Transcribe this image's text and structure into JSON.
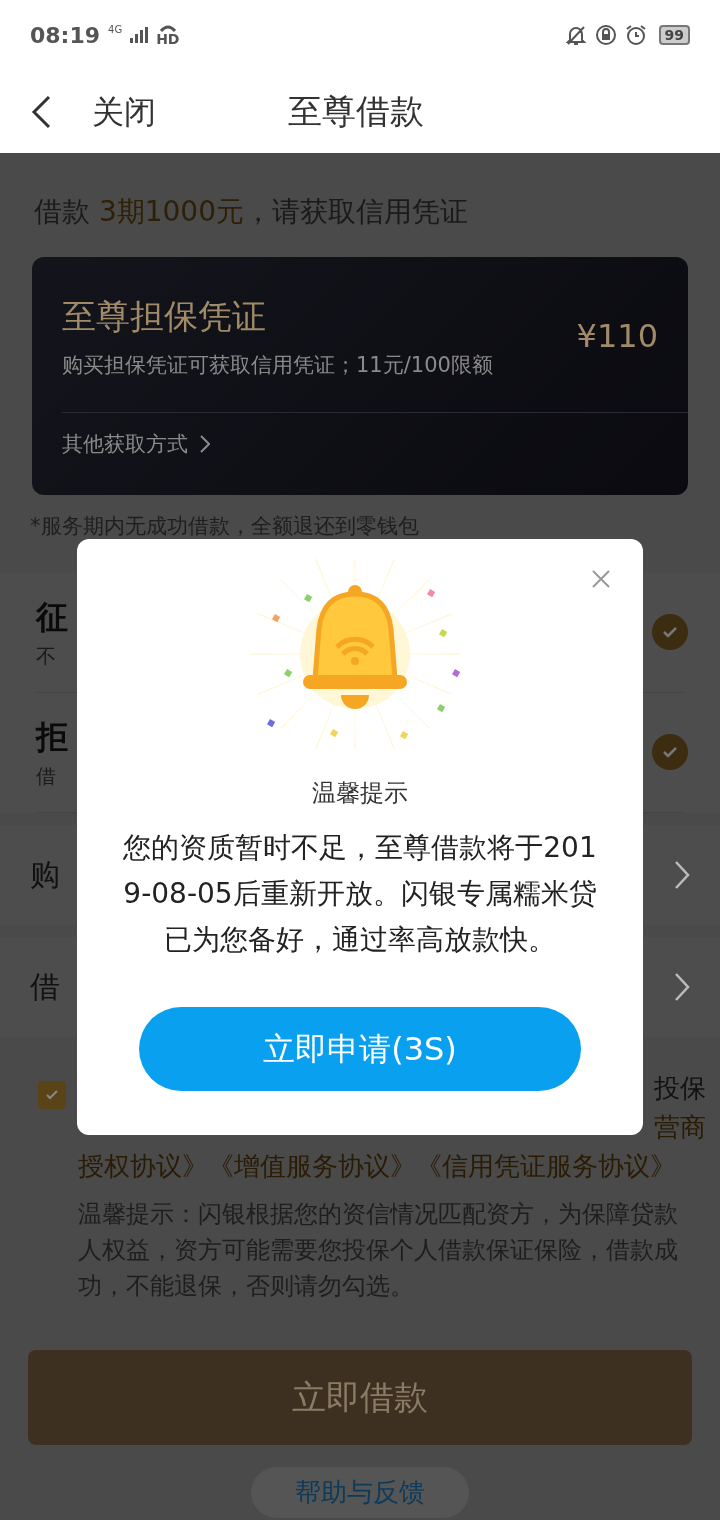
{
  "status_bar": {
    "time": "08:19",
    "network": "4G",
    "call_label": "HD",
    "battery": "99"
  },
  "header": {
    "back_label": "关闭",
    "title": "至尊借款"
  },
  "loan_summary": {
    "prefix": "借款",
    "highlight": "3期1000元",
    "suffix": "，请获取信用凭证"
  },
  "voucher_card": {
    "title": "至尊担保凭证",
    "description": "购买担保凭证可获取信用凭证；11元/100限额",
    "price": "¥110",
    "other_methods": "其他获取方式"
  },
  "refund_note": "*服务期内无成功借款，全额退还到零钱包",
  "check_items": [
    {
      "title": "征",
      "subtitle": "不",
      "checked": true
    },
    {
      "title": "拒",
      "subtitle": "借",
      "checked": true
    }
  ],
  "nav_rows": [
    {
      "label": "购"
    },
    {
      "label": "借"
    }
  ],
  "agreement": {
    "checked": true,
    "line_1_end": "投保",
    "line_2_end": "营商",
    "line_3": "授权协议》《增值服务协议》《信用凭证服务协议》"
  },
  "tip": "温馨提示：闪银根据您的资信情况匹配资方，为保障贷款人权益，资方可能需要您投保个人借款保证保险，借款成功，不能退保，否则请勿勾选。",
  "submit_button": "立即借款",
  "help_link": "帮助与反馈",
  "dialog": {
    "title": "温馨提示",
    "message": "您的资质暂时不足，至尊借款将于2019-08-05后重新开放。闪银专属糯米贷已为您备好，通过率高放款快。",
    "button": "立即申请(3S)"
  }
}
